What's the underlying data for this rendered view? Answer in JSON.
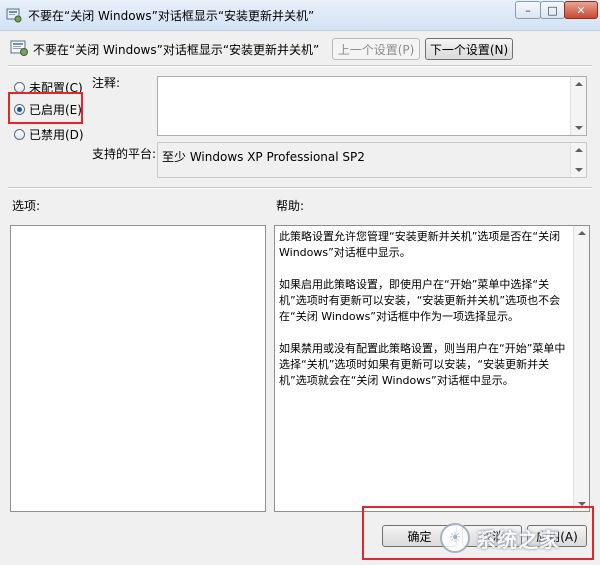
{
  "window": {
    "title": "不要在“关闭 Windows”对话框显示“安装更新并关机”",
    "controls": {
      "minimize": "–",
      "maximize": "□",
      "close": "✕"
    }
  },
  "header": {
    "policy_name": "不要在“关闭 Windows”对话框显示“安装更新并关机”",
    "prev_button": "上一个设置(P)",
    "next_button": "下一个设置(N)"
  },
  "state_options": [
    {
      "label": "未配置(C)",
      "checked": false
    },
    {
      "label": "已启用(E)",
      "checked": true
    },
    {
      "label": "已禁用(D)",
      "checked": false
    }
  ],
  "comment": {
    "label": "注释:",
    "value": ""
  },
  "platform": {
    "label": "支持的平台:",
    "value": "至少 Windows XP Professional SP2"
  },
  "options": {
    "label": "选项:"
  },
  "help": {
    "label": "帮助:",
    "paragraphs": [
      "此策略设置允许您管理“安装更新并关机”选项是否在“关闭 Windows”对话框中显示。",
      "如果启用此策略设置，即使用户在“开始”菜单中选择“关机”选项时有更新可以安装，“安装更新并关机”选项也不会在“关闭 Windows”对话框中作为一项选择显示。",
      "如果禁用或没有配置此策略设置，则当用户在“开始”菜单中选择“关机”选项时如果有更新可以安装，“安装更新并关机”选项就会在“关闭 Windows”对话框中显示。"
    ]
  },
  "footer": {
    "ok_button": "确定",
    "cancel_button": "取消",
    "apply_button": "应用(A)"
  },
  "watermark": {
    "text": "系统之家"
  },
  "colors": {
    "highlight_box": "#e0282b",
    "titlebar": "#d3e2f4"
  }
}
